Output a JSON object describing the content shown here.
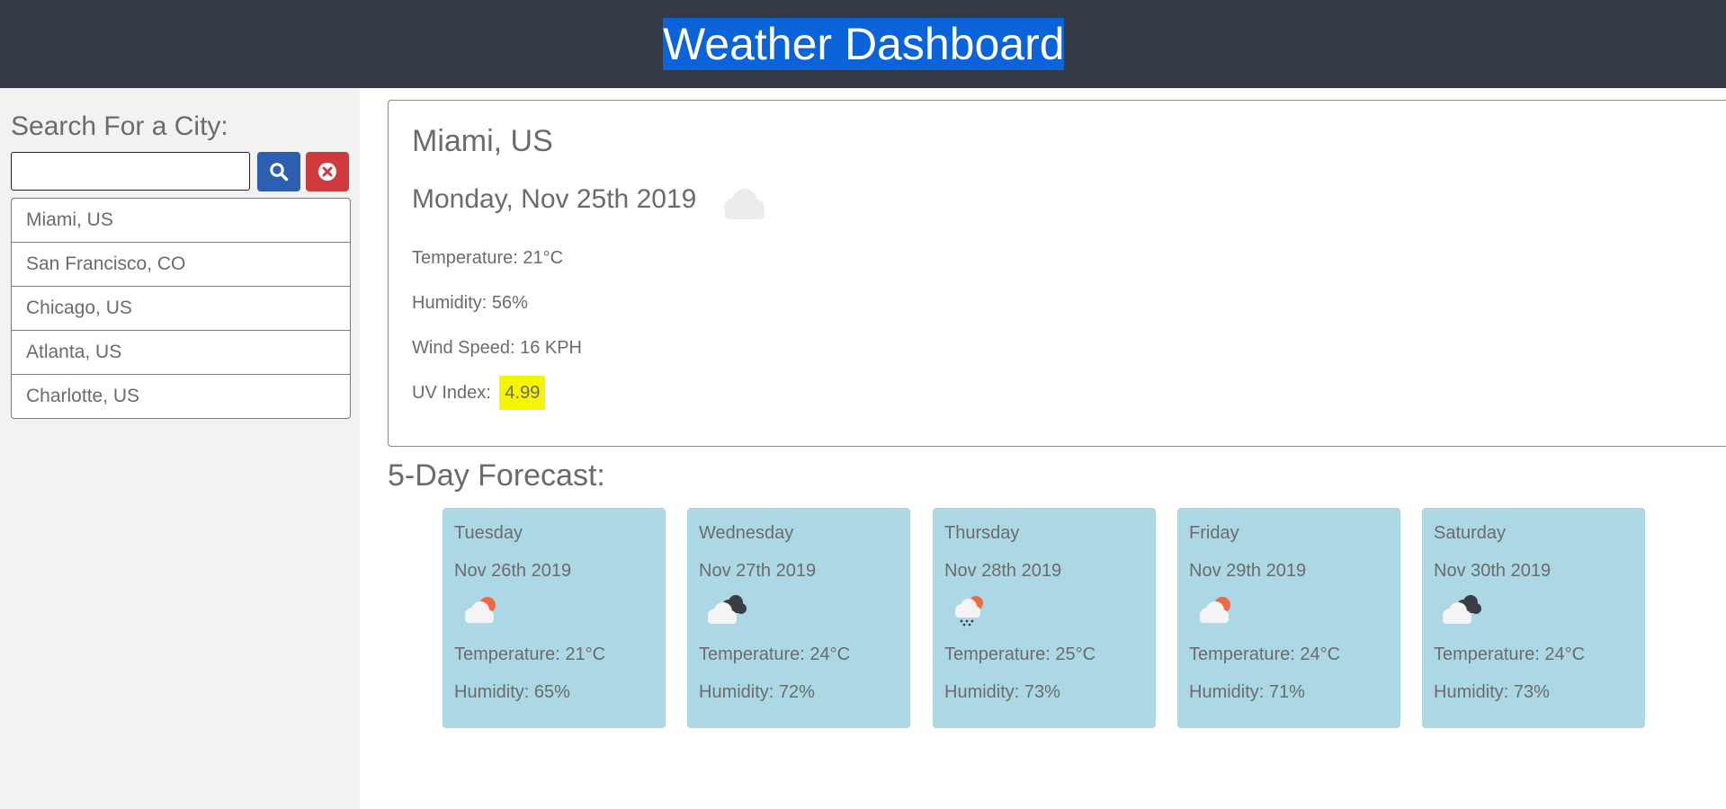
{
  "header": {
    "title": "Weather Dashboard"
  },
  "sidebar": {
    "search_label": "Search For a City:",
    "search_value": "",
    "cities": [
      "Miami, US",
      "San Francisco, CO",
      "Chicago, US",
      "Atlanta, US",
      "Charlotte, US"
    ]
  },
  "current": {
    "city": "Miami, US",
    "date": "Monday, Nov 25th 2019",
    "icon": "cloud-icon",
    "temperature": "Temperature: 21°C",
    "humidity": "Humidity: 56%",
    "wind": "Wind Speed: 16 KPH",
    "uv_label": "UV Index:",
    "uv_value": "4.99"
  },
  "forecast": {
    "title": "5-Day Forecast:",
    "days": [
      {
        "day": "Tuesday",
        "date": "Nov 26th 2019",
        "icon": "partly-cloudy-day-icon",
        "temperature": "Temperature: 21°C",
        "humidity": "Humidity: 65%"
      },
      {
        "day": "Wednesday",
        "date": "Nov 27th 2019",
        "icon": "broken-clouds-icon",
        "temperature": "Temperature: 24°C",
        "humidity": "Humidity: 72%"
      },
      {
        "day": "Thursday",
        "date": "Nov 28th 2019",
        "icon": "rain-sun-icon",
        "temperature": "Temperature: 25°C",
        "humidity": "Humidity: 73%"
      },
      {
        "day": "Friday",
        "date": "Nov 29th 2019",
        "icon": "partly-cloudy-day-icon",
        "temperature": "Temperature: 24°C",
        "humidity": "Humidity: 71%"
      },
      {
        "day": "Saturday",
        "date": "Nov 30th 2019",
        "icon": "broken-clouds-icon",
        "temperature": "Temperature: 24°C",
        "humidity": "Humidity: 73%"
      }
    ]
  },
  "colors": {
    "header_bg": "#343a45",
    "title_highlight": "#0a63d9",
    "search_button": "#2d5fb0",
    "clear_button": "#cf3b3d",
    "forecast_card": "#acd8e5",
    "uv_badge": "#f5f500"
  }
}
